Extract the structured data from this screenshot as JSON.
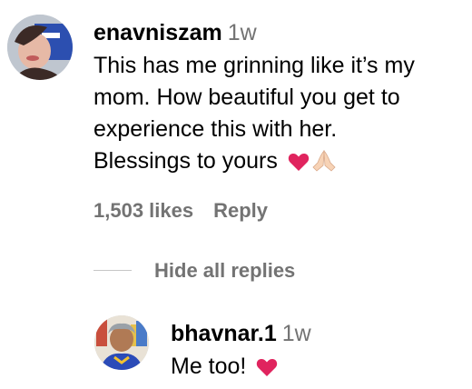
{
  "comments": [
    {
      "username": "enavniszam",
      "time": "1w",
      "text_lines": [
        "This has me grinning like it’s my",
        "mom. How beautiful you get to",
        "experience this with her.",
        "Blessings to yours"
      ],
      "emoji_names": [
        "red-heart-icon",
        "folded-hands-icon"
      ],
      "likes": "1,503 likes",
      "reply_label": "Reply"
    }
  ],
  "replies_toggle": {
    "label": "Hide all replies"
  },
  "replies": [
    {
      "username": "bhavnar.1",
      "time": "1w",
      "text": "Me too!",
      "emoji_names": [
        "red-heart-icon"
      ]
    }
  ],
  "colors": {
    "text": "#000000",
    "secondary": "#737373",
    "divider": "#c7c7c7",
    "heart": "#e0245e"
  }
}
